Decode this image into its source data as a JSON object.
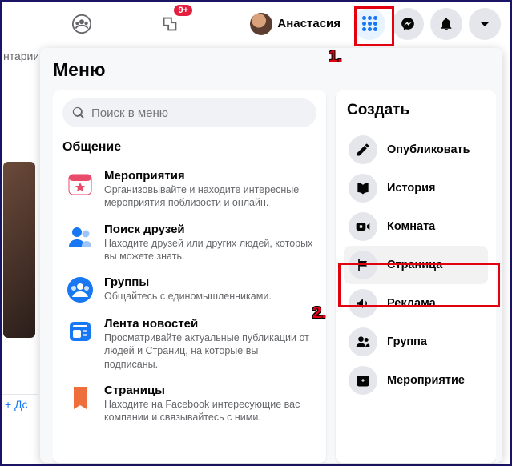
{
  "nav": {
    "badge": "9+",
    "profile_name": "Анастасия"
  },
  "sliver": {
    "text": "нтарии",
    "btn": "Дс"
  },
  "menu": {
    "title": "Меню",
    "search_placeholder": "Поиск в меню",
    "section": "Общение",
    "items": [
      {
        "title": "Мероприятия",
        "desc": "Организовывайте и находите интересные мероприятия поблизости и онлайн."
      },
      {
        "title": "Поиск друзей",
        "desc": "Находите друзей или других людей, которых вы можете знать."
      },
      {
        "title": "Группы",
        "desc": "Общайтесь с единомышленниками."
      },
      {
        "title": "Лента новостей",
        "desc": "Просматривайте актуальные публикации от людей и Страниц, на которые вы подписаны."
      },
      {
        "title": "Страницы",
        "desc": "Находите на Facebook интересующие вас компании и связывайтесь с ними."
      }
    ]
  },
  "create": {
    "title": "Создать",
    "items": [
      "Опубликовать",
      "История",
      "Комната",
      "Страница",
      "Реклама",
      "Группа",
      "Мероприятие"
    ]
  },
  "annotations": {
    "one": "1.",
    "two": "2."
  }
}
